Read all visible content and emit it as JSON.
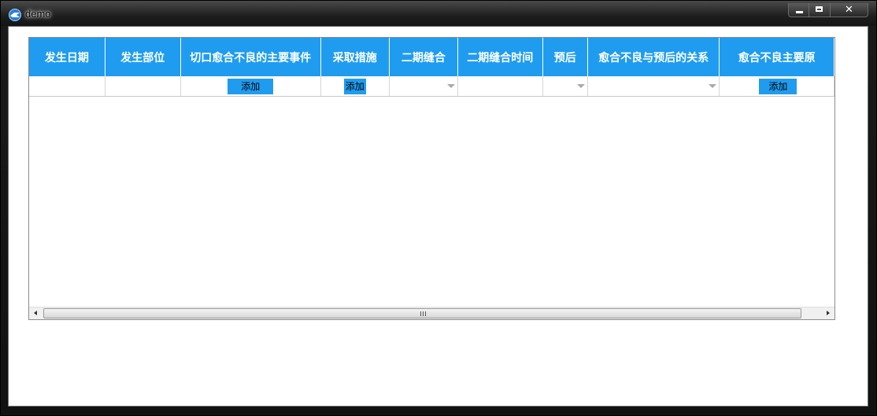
{
  "window": {
    "title": "demo",
    "close_glyph": "✕"
  },
  "table": {
    "columns": [
      {
        "label": "发生日期",
        "kind": "text"
      },
      {
        "label": "发生部位",
        "kind": "text"
      },
      {
        "label": "切口愈合不良的主要事件",
        "kind": "button"
      },
      {
        "label": "采取措施",
        "kind": "button"
      },
      {
        "label": "二期缝合",
        "kind": "combo"
      },
      {
        "label": "二期缝合时间",
        "kind": "text"
      },
      {
        "label": "预后",
        "kind": "combo"
      },
      {
        "label": "愈合不良与预后的关系",
        "kind": "combo"
      },
      {
        "label": "愈合不良主要原",
        "kind": "button"
      }
    ],
    "add_label": "添加",
    "scroll_grip": "|||"
  },
  "colors": {
    "header_bg": "#1f9cf0",
    "header_text": "#ffffff",
    "button_bg": "#1f9cf0"
  },
  "icons": {
    "app": "app-logo-icon",
    "minimize": "minimize-icon",
    "maximize": "maximize-icon",
    "close": "close-icon",
    "combo": "chevron-down-icon",
    "scroll_left": "scroll-left-icon",
    "scroll_right": "scroll-right-icon"
  }
}
